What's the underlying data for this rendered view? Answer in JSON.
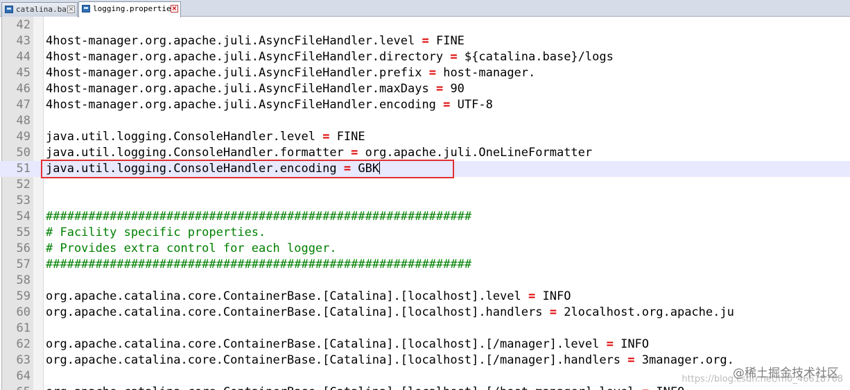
{
  "tabs": [
    {
      "label": "catalina.bat",
      "active": false,
      "icon": "file-icon"
    },
    {
      "label": "logging.properties",
      "active": true,
      "icon": "file-icon"
    }
  ],
  "editor": {
    "current_line": 51,
    "lines": [
      {
        "n": "42",
        "text": ""
      },
      {
        "n": "43",
        "key": "4host-manager.org.apache.juli.AsyncFileHandler.level",
        "val": "FINE"
      },
      {
        "n": "44",
        "key": "4host-manager.org.apache.juli.AsyncFileHandler.directory",
        "val": "${catalina.base}/logs"
      },
      {
        "n": "45",
        "key": "4host-manager.org.apache.juli.AsyncFileHandler.prefix",
        "val": "host-manager."
      },
      {
        "n": "46",
        "key": "4host-manager.org.apache.juli.AsyncFileHandler.maxDays",
        "val": "90"
      },
      {
        "n": "47",
        "key": "4host-manager.org.apache.juli.AsyncFileHandler.encoding",
        "val": "UTF-8"
      },
      {
        "n": "48",
        "text": ""
      },
      {
        "n": "49",
        "key": "java.util.logging.ConsoleHandler.level",
        "val": "FINE"
      },
      {
        "n": "50",
        "key": "java.util.logging.ConsoleHandler.formatter",
        "val": "org.apache.juli.OneLineFormatter"
      },
      {
        "n": "51",
        "key": "java.util.logging.ConsoleHandler.encoding",
        "val": "GBK"
      },
      {
        "n": "52",
        "text": ""
      },
      {
        "n": "53",
        "text": ""
      },
      {
        "n": "54",
        "comment": "############################################################"
      },
      {
        "n": "55",
        "comment": "# Facility specific properties."
      },
      {
        "n": "56",
        "comment": "# Provides extra control for each logger."
      },
      {
        "n": "57",
        "comment": "############################################################"
      },
      {
        "n": "58",
        "text": ""
      },
      {
        "n": "59",
        "key": "org.apache.catalina.core.ContainerBase.[Catalina].[localhost].level",
        "val": "INFO"
      },
      {
        "n": "60",
        "key": "org.apache.catalina.core.ContainerBase.[Catalina].[localhost].handlers",
        "val": "2localhost.org.apache.ju"
      },
      {
        "n": "61",
        "text": ""
      },
      {
        "n": "62",
        "key": "org.apache.catalina.core.ContainerBase.[Catalina].[localhost].[/manager].level",
        "val": "INFO"
      },
      {
        "n": "63",
        "key": "org.apache.catalina.core.ContainerBase.[Catalina].[localhost].[/manager].handlers",
        "val": "3manager.org."
      },
      {
        "n": "64",
        "text": ""
      },
      {
        "n": "65",
        "key": "org.apache.catalina.core.ContainerBase.[Catalina].[localhost].[/host-manager].level",
        "val": "INFO"
      }
    ]
  },
  "operator": "=",
  "watermark": {
    "main": "@稀土掘金技术社区",
    "faint": "https://blog.csdn.net/m0_46618768"
  },
  "colors": {
    "operator": "#e00000",
    "comment": "#008000",
    "line_number": "#808080",
    "current_line_bg": "#e8e8ff",
    "highlight_box": "#e03030"
  }
}
